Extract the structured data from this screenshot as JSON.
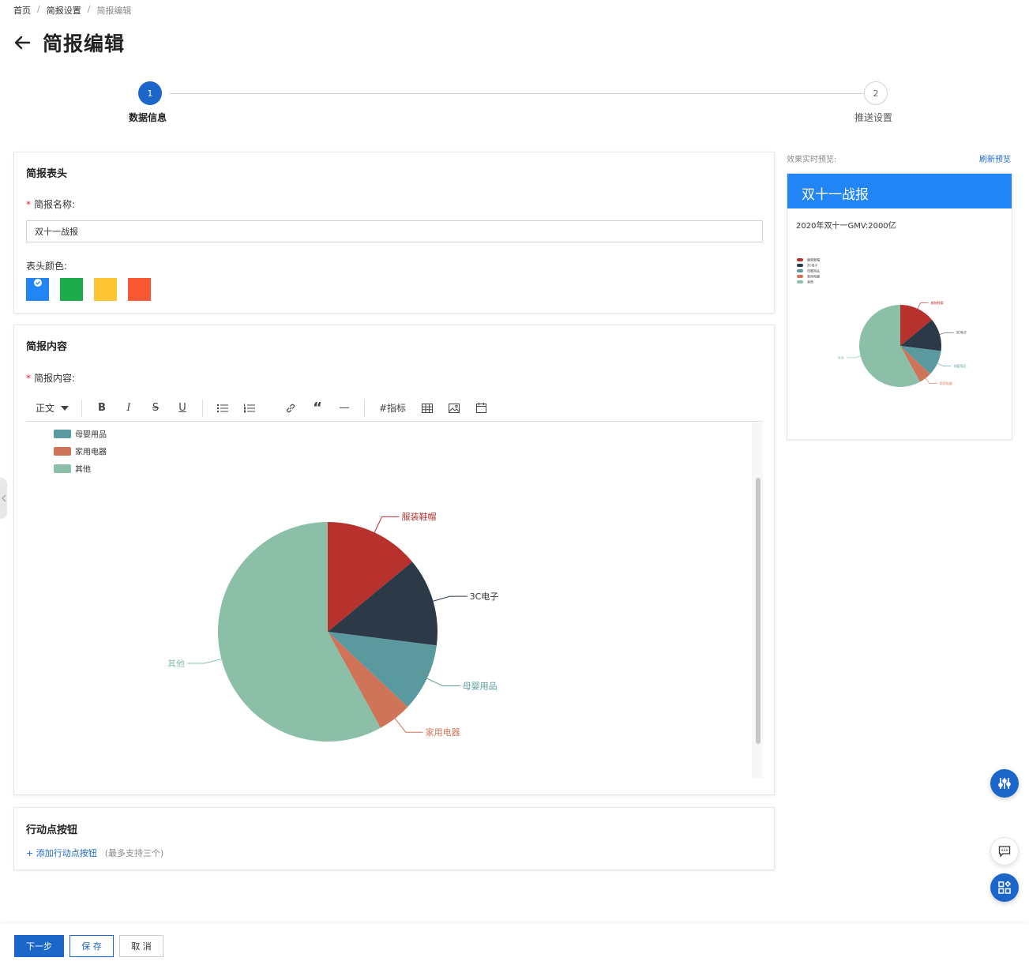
{
  "breadcrumb": {
    "home": "首页",
    "settings": "简报设置",
    "current": "简报编辑",
    "sep": "/"
  },
  "header": {
    "title": "简报编辑"
  },
  "steps": [
    {
      "index": "1",
      "label": "数据信息"
    },
    {
      "index": "2",
      "label": "推送设置"
    }
  ],
  "brief_header_section": {
    "title": "简报表头",
    "name_label": "简报名称:",
    "name_value": "双十一战报",
    "color_label": "表头颜色:",
    "colors": [
      "#2185f6",
      "#1bab4a",
      "#fcc531",
      "#fb5733"
    ],
    "selected_color": "#2185f6"
  },
  "content_section": {
    "title": "简报内容",
    "content_label": "简报内容:",
    "toolbar": {
      "format_select": "正文",
      "bold": "B",
      "italic": "I",
      "strike": "S",
      "underline": "U",
      "bullet_list_icon": "bullet-list-icon",
      "ordered_list_icon": "ordered-list-icon",
      "link_icon": "link-icon",
      "quote": "“",
      "hr": "—",
      "metric": "#指标",
      "table_icon": "table-icon",
      "image_icon": "image-icon",
      "calendar_icon": "calendar-icon"
    }
  },
  "action_section": {
    "title": "行动点按钮",
    "add_link": "+ 添加行动点按钮",
    "hint": "(最多支持三个)"
  },
  "preview": {
    "label": "效果实时预览:",
    "refresh": "刷新预览",
    "head_title": "双十一战报",
    "text": "2020年双十一GMV:2000亿"
  },
  "chart_data": {
    "type": "pie",
    "title": "",
    "series": [
      {
        "name": "服装鞋帽",
        "value": 14,
        "color": "#b7312d"
      },
      {
        "name": "3C电子",
        "value": 13,
        "color": "#2c3a47"
      },
      {
        "name": "母婴用品",
        "value": 10,
        "color": "#5a9a9f"
      },
      {
        "name": "家用电器",
        "value": 5,
        "color": "#cf7458"
      },
      {
        "name": "其他",
        "value": 58,
        "color": "#8bbfa8"
      }
    ]
  },
  "footer": {
    "next": "下一步",
    "save": "保 存",
    "cancel": "取 消"
  }
}
